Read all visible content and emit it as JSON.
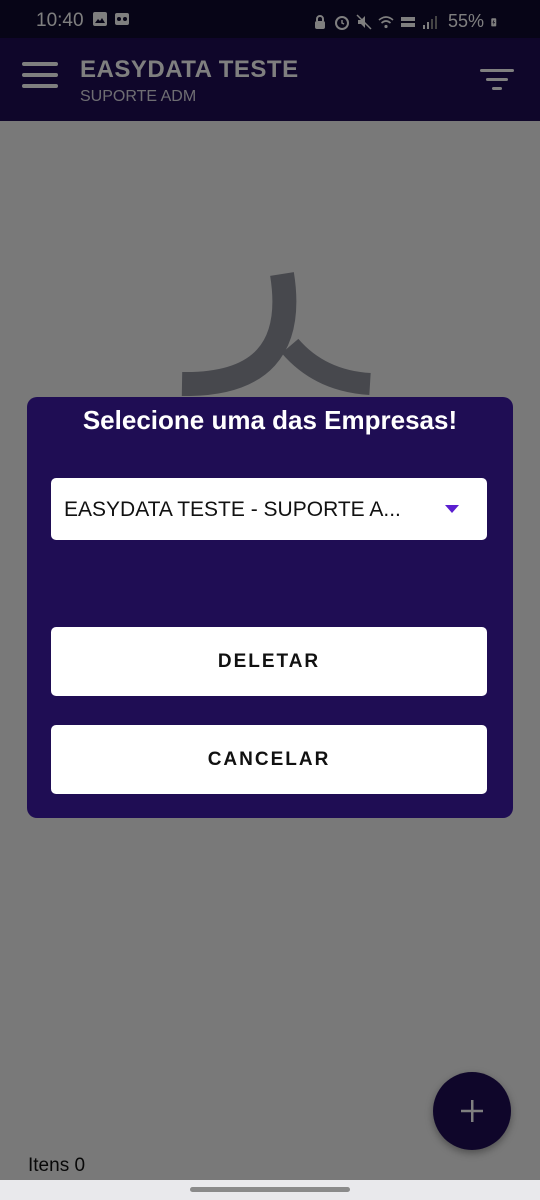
{
  "status_bar": {
    "time": "10:40",
    "battery": "55%",
    "left_icons": [
      "gallery-icon",
      "voicemail-icon"
    ],
    "right_icons": [
      "lock-icon",
      "alarm-icon",
      "mute-icon",
      "wifi-icon",
      "volte-icon",
      "signal-icon",
      "battery-icon"
    ]
  },
  "app_bar": {
    "title": "EASYDATA TESTE",
    "subtitle": "SUPORTE ADM",
    "menu_icon": "menu-icon",
    "filter_icon": "filter-icon"
  },
  "main": {
    "items_count": "Itens 0",
    "fab_icon": "plus-icon"
  },
  "dialog": {
    "title": "Selecione uma das Empresas!",
    "company_select_value": "EASYDATA TESTE - SUPORTE A...",
    "delete_label": "DELETAR",
    "cancel_label": "CANCELAR"
  },
  "colors": {
    "primary": "#1f0d54",
    "status_bar": "#0f0a2e",
    "accent": "#5b1fd0",
    "button_bg": "#ffffff"
  }
}
